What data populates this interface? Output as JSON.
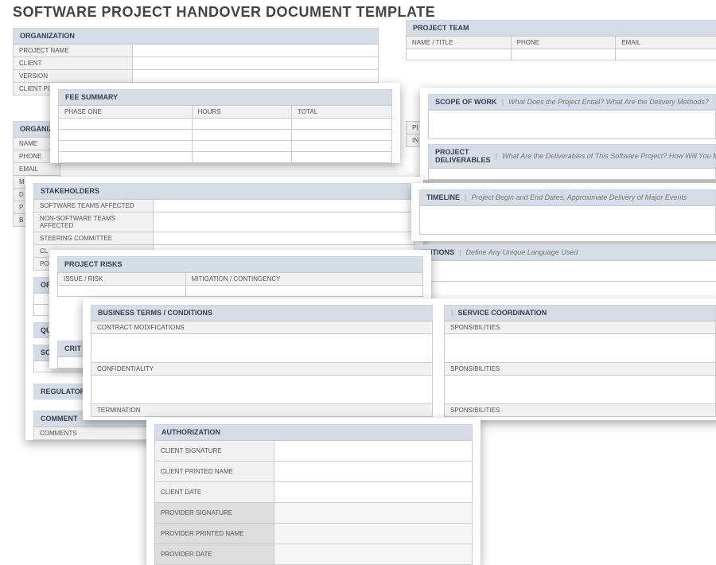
{
  "title": "SOFTWARE PROJECT HANDOVER DOCUMENT TEMPLATE",
  "organization": {
    "header": "ORGANIZATION",
    "rows": [
      "PROJECT NAME",
      "CLIENT",
      "VERSION",
      "CLIENT PO"
    ]
  },
  "organiz2": {
    "header": "ORGANIZ",
    "rows": [
      "NAME",
      "PHONE",
      "EMAIL",
      "M",
      "D",
      "P",
      "B"
    ]
  },
  "projectTeam": {
    "header": "PROJECT TEAM",
    "cols": [
      "NAME / TITLE",
      "PHONE",
      "EMAIL"
    ]
  },
  "feeSummary": {
    "header": "FEE SUMMARY",
    "cols": [
      "PHASE ONE",
      "HOURS",
      "TOTAL"
    ]
  },
  "scope": {
    "header": "SCOPE OF WORK",
    "hint": "What Does the Project Entail? What Are the Delivery Methods?"
  },
  "deliverables": {
    "header": "PROJECT DELIVERABLES",
    "hint": "What Are the Deliverables of This Software Project? How Will You Mea"
  },
  "timeline": {
    "header": "TIMELINE",
    "hint": "Project Begin and End Dates, Approximate Delivery of Major Events"
  },
  "rightfrag": {
    "rows": [
      "PI",
      "IN"
    ]
  },
  "definitions": {
    "headerFrag": "INITIONS",
    "hint": "Define Any Unique Language Used"
  },
  "stakeholders": {
    "header": "STAKEHOLDERS",
    "rows": [
      "SOFTWARE TEAMS AFFECTED",
      "NON-SOFTWARE TEAMS AFFECTED",
      "STEERING COMMITTEE",
      "CL",
      "PO"
    ]
  },
  "projectRisks": {
    "header": "PROJECT RISKS",
    "cols": [
      "ISSUE / RISK",
      "MITIGATION / CONTINGENCY"
    ]
  },
  "critHeader": "CRIT",
  "opHeader": "OP",
  "quHeader": "QU",
  "soHeader": "SO",
  "regHeader": "REGULATORY",
  "commentHeader": "COMMENT",
  "commentsRow": "COMMENTS",
  "biz": {
    "header": "BUSINESS TERMS / CONDITIONS",
    "rows": [
      "CONTRACT MODIFICATIONS",
      "CONFIDENTIALITY",
      "TERMINATION"
    ]
  },
  "serviceCoord": {
    "headerFrag": "SERVICE COORDINATION",
    "rows": [
      "SPONSIBILITIES",
      "SPONSIBILITIES",
      "SPONSIBILITIES"
    ]
  },
  "authorization": {
    "header": "AUTHORIZATION",
    "rows": [
      "CLIENT SIGNATURE",
      "CLIENT PRINTED NAME",
      "CLIENT DATE",
      "PROVIDER SIGNATURE",
      "PROVIDER PRINTED NAME",
      "PROVIDER DATE"
    ]
  }
}
